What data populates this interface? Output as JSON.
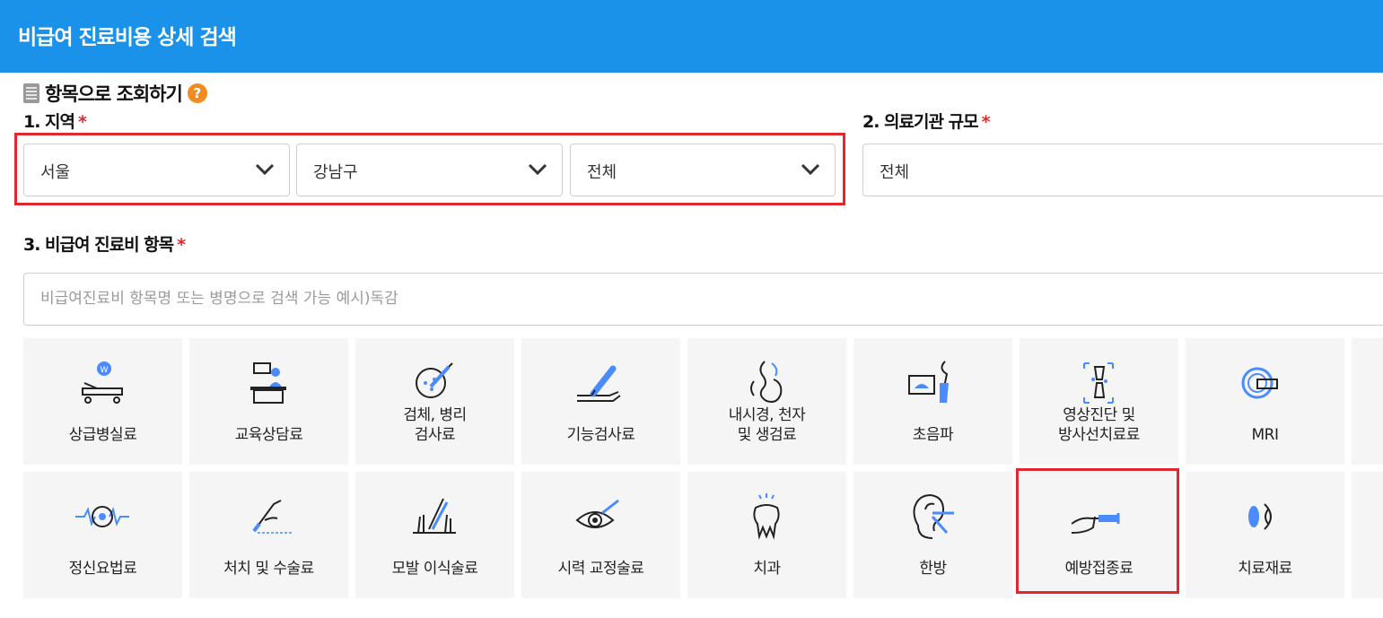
{
  "header": {
    "title": "비급여 진료비용 상세 검색"
  },
  "section": {
    "title": "항목으로 조회하기",
    "help": "?"
  },
  "region": {
    "label": "1. 지역",
    "required_mark": "*",
    "selects": [
      "서울",
      "강남구",
      "전체"
    ]
  },
  "institution": {
    "label": "2. 의료기관 규모",
    "required_mark": "*",
    "value": "전체"
  },
  "item": {
    "label": "3. 비급여 진료비 항목",
    "required_mark": "*",
    "placeholder": "비급여진료비 항목명 또는 병명으로 검색 가능 예시)독감"
  },
  "categories_row1": [
    {
      "label": "상급병실료",
      "icon": "hospital-bed-icon"
    },
    {
      "label": "교육상담료",
      "icon": "counseling-icon"
    },
    {
      "label": "검체, 병리\n검사료",
      "icon": "specimen-dish-icon"
    },
    {
      "label": "기능검사료",
      "icon": "thermometer-arm-icon"
    },
    {
      "label": "내시경, 천자\n및 생검료",
      "icon": "endoscope-icon"
    },
    {
      "label": "초음파",
      "icon": "ultrasound-icon"
    },
    {
      "label": "영상진단 및\n방사선치료료",
      "icon": "xray-joint-icon"
    },
    {
      "label": "MRI",
      "icon": "mri-scanner-icon"
    }
  ],
  "categories_row2": [
    {
      "label": "정신요법료",
      "icon": "brain-wave-icon"
    },
    {
      "label": "처치 및 수술료",
      "icon": "scalpel-hand-icon"
    },
    {
      "label": "모발 이식술료",
      "icon": "hair-transplant-icon"
    },
    {
      "label": "시력 교정술료",
      "icon": "eye-laser-icon"
    },
    {
      "label": "치과",
      "icon": "tooth-icon"
    },
    {
      "label": "한방",
      "icon": "ear-acupuncture-icon"
    },
    {
      "label": "예방접종료",
      "icon": "vaccine-syringe-icon"
    },
    {
      "label": "치료재료",
      "icon": "eye-lens-icon"
    }
  ],
  "colors": {
    "header": "#1b92ea",
    "accent": "#4a8cff",
    "highlight": "#e0282e",
    "tile": "#f5f5f5"
  }
}
